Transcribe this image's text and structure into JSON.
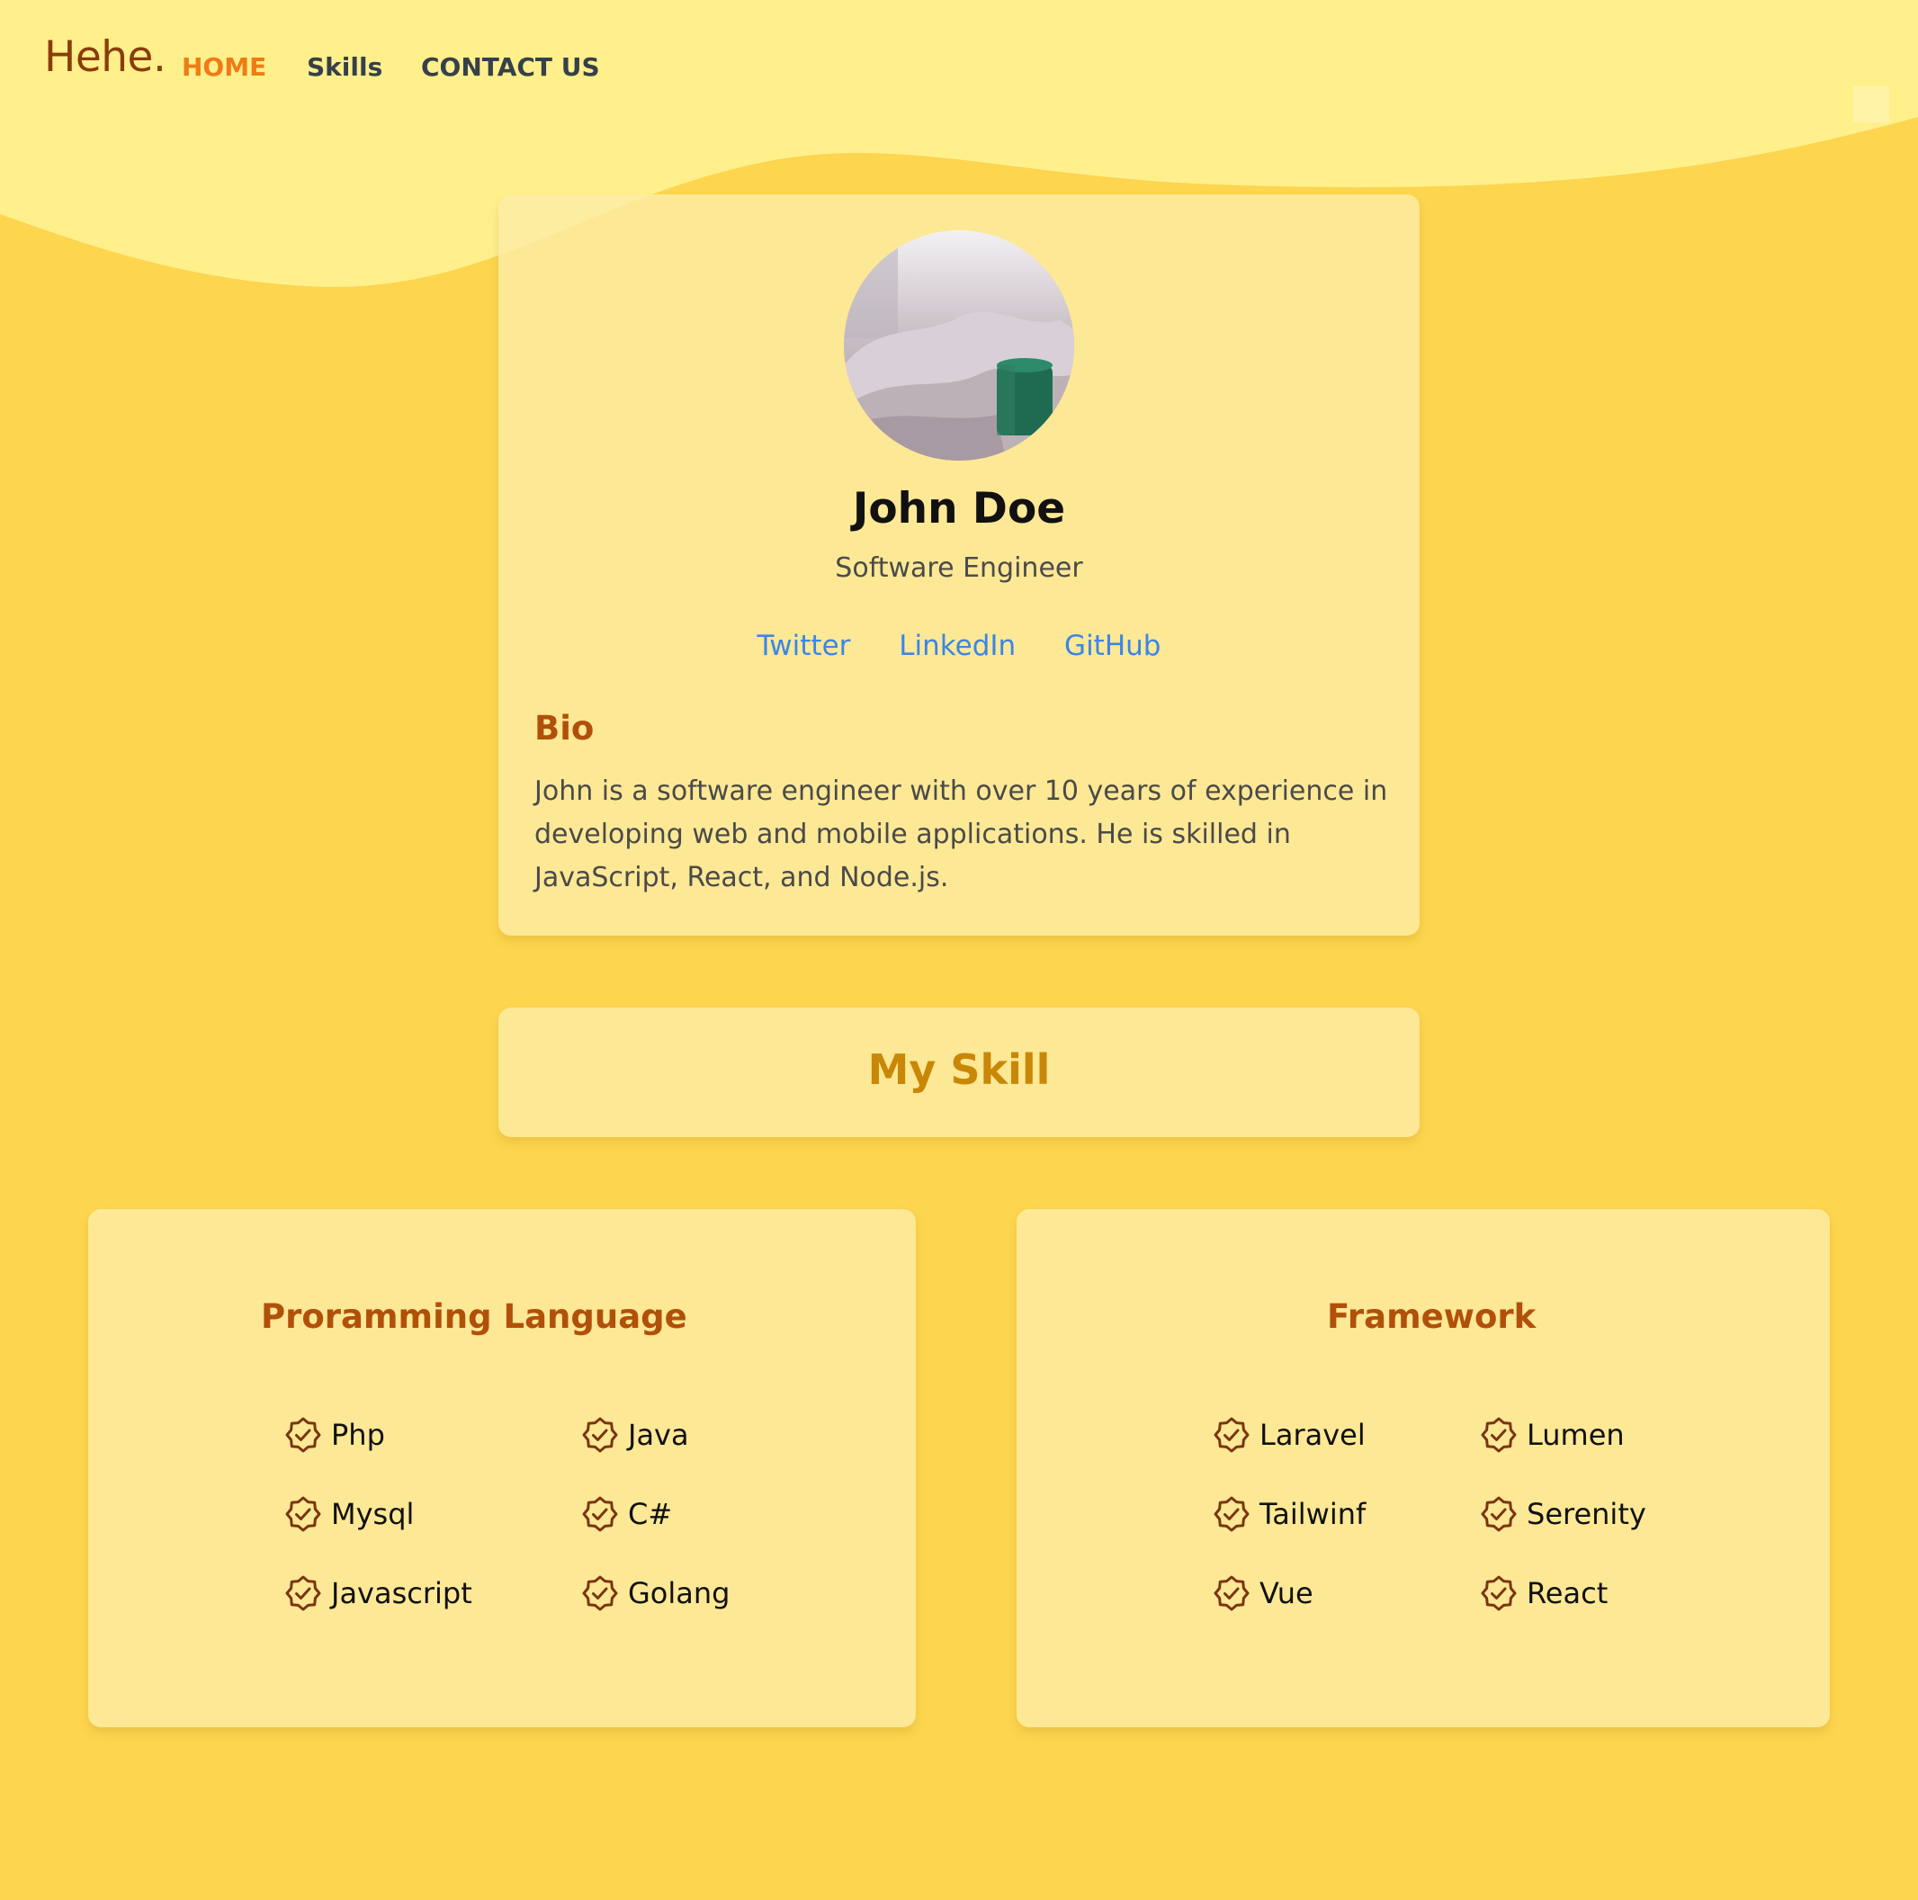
{
  "nav": {
    "logo": "Hehe.",
    "links": [
      {
        "label": "HOME",
        "active": true
      },
      {
        "label": "Skills",
        "active": false
      },
      {
        "label": "CONTACT US",
        "active": false
      }
    ]
  },
  "profile": {
    "name": "John Doe",
    "title": "Software Engineer",
    "socials": [
      "Twitter",
      "LinkedIn",
      "GitHub"
    ],
    "bio_heading": "Bio",
    "bio_text": "John is a software engineer with over 10 years of experience in developing web and mobile applications. He is skilled in JavaScript, React, and Node.js."
  },
  "skills": {
    "heading": "My Skill",
    "groups": [
      {
        "title": "Proramming Language",
        "items": [
          "Php",
          "Java",
          "Mysql",
          "C#",
          "Javascript",
          "Golang"
        ]
      },
      {
        "title": "Framework",
        "items": [
          "Laravel",
          "Lumen",
          "Tailwinf",
          "Serenity",
          "Vue",
          "React"
        ]
      }
    ]
  },
  "colors": {
    "background": "#fdd54f",
    "wave": "#fff08c",
    "card": "#fce9a4",
    "nav_active": "#f07b14",
    "heading_brown": "#b1500a",
    "skill_title": "#c98708",
    "link_blue": "#3a86e8",
    "check_icon": "#7a3510"
  },
  "icons": {
    "skill_item": "check-badge-icon"
  }
}
